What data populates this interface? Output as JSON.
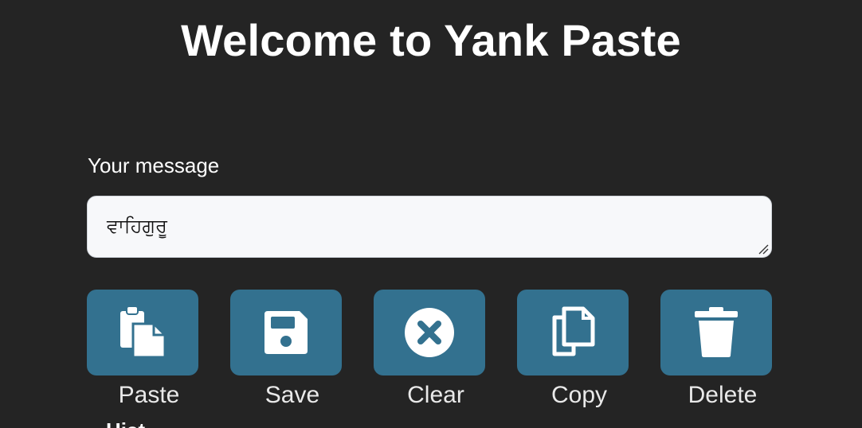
{
  "header": {
    "title": "Welcome to Yank Paste"
  },
  "form": {
    "label": "Your message",
    "message_value": "ਵਾਹਿਗੁਰੂ"
  },
  "actions": [
    {
      "label": "Paste",
      "icon": "paste-icon"
    },
    {
      "label": "Save",
      "icon": "save-icon"
    },
    {
      "label": "Clear",
      "icon": "clear-icon"
    },
    {
      "label": "Copy",
      "icon": "copy-icon"
    },
    {
      "label": "Delete",
      "icon": "delete-icon"
    }
  ],
  "history": {
    "label": "Hist"
  },
  "colors": {
    "background": "#242424",
    "button": "#33718f",
    "input_background": "#f7f8fa"
  }
}
